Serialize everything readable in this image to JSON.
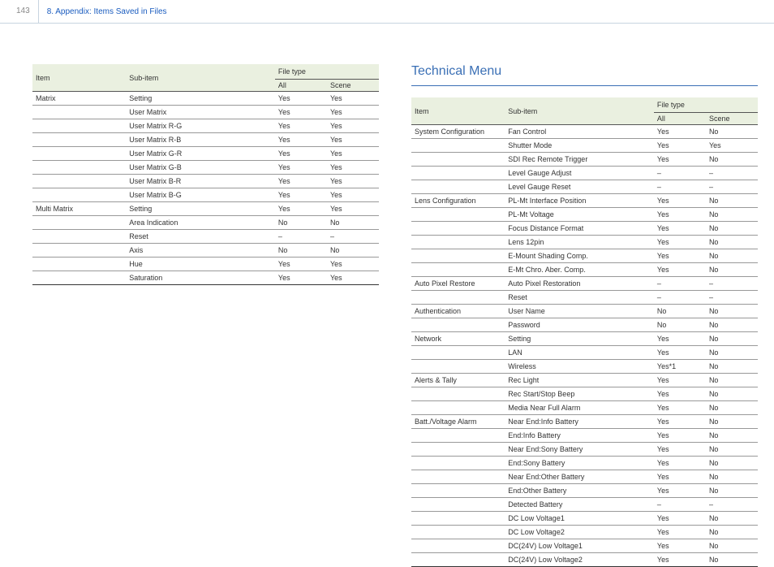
{
  "header": {
    "page_number": "143",
    "title": "8. Appendix: Items Saved in Files"
  },
  "table_headers": {
    "item": "Item",
    "sub_item": "Sub-item",
    "file_type": "File type",
    "all": "All",
    "scene": "Scene"
  },
  "right_heading": "Technical Menu",
  "left_table": [
    {
      "item": "Matrix",
      "rows": [
        {
          "sub": "Setting",
          "all": "Yes",
          "scene": "Yes"
        },
        {
          "sub": "User Matrix",
          "all": "Yes",
          "scene": "Yes"
        },
        {
          "sub": "User Matrix R-G",
          "all": "Yes",
          "scene": "Yes"
        },
        {
          "sub": "User Matrix R-B",
          "all": "Yes",
          "scene": "Yes"
        },
        {
          "sub": "User Matrix G-R",
          "all": "Yes",
          "scene": "Yes"
        },
        {
          "sub": "User Matrix G-B",
          "all": "Yes",
          "scene": "Yes"
        },
        {
          "sub": "User Matrix B-R",
          "all": "Yes",
          "scene": "Yes"
        },
        {
          "sub": "User Matrix B-G",
          "all": "Yes",
          "scene": "Yes"
        }
      ]
    },
    {
      "item": "Multi Matrix",
      "rows": [
        {
          "sub": "Setting",
          "all": "Yes",
          "scene": "Yes"
        },
        {
          "sub": "Area Indication",
          "all": "No",
          "scene": "No"
        },
        {
          "sub": "Reset",
          "all": "–",
          "scene": "–"
        },
        {
          "sub": "Axis",
          "all": "No",
          "scene": "No"
        },
        {
          "sub": "Hue",
          "all": "Yes",
          "scene": "Yes"
        },
        {
          "sub": "Saturation",
          "all": "Yes",
          "scene": "Yes"
        }
      ]
    }
  ],
  "right_table": [
    {
      "item": "System Configuration",
      "rows": [
        {
          "sub": "Fan Control",
          "all": "Yes",
          "scene": "No"
        },
        {
          "sub": "Shutter Mode",
          "all": "Yes",
          "scene": "Yes"
        },
        {
          "sub": "SDI Rec Remote Trigger",
          "all": "Yes",
          "scene": "No"
        },
        {
          "sub": "Level Gauge Adjust",
          "all": "–",
          "scene": "–"
        },
        {
          "sub": "Level Gauge Reset",
          "all": "–",
          "scene": "–"
        }
      ]
    },
    {
      "item": "Lens Configuration",
      "rows": [
        {
          "sub": "PL-Mt Interface Position",
          "all": "Yes",
          "scene": "No"
        },
        {
          "sub": "PL-Mt Voltage",
          "all": "Yes",
          "scene": "No"
        },
        {
          "sub": "Focus Distance Format",
          "all": "Yes",
          "scene": "No"
        },
        {
          "sub": "Lens 12pin",
          "all": "Yes",
          "scene": "No"
        },
        {
          "sub": "E-Mount Shading Comp.",
          "all": "Yes",
          "scene": "No"
        },
        {
          "sub": "E-Mt Chro. Aber. Comp.",
          "all": "Yes",
          "scene": "No"
        }
      ]
    },
    {
      "item": "Auto Pixel Restore",
      "rows": [
        {
          "sub": "Auto Pixel Restoration",
          "all": "–",
          "scene": "–"
        },
        {
          "sub": "Reset",
          "all": "–",
          "scene": "–"
        }
      ]
    },
    {
      "item": "Authentication",
      "rows": [
        {
          "sub": "User Name",
          "all": "No",
          "scene": "No"
        },
        {
          "sub": "Password",
          "all": "No",
          "scene": "No"
        }
      ]
    },
    {
      "item": "Network",
      "rows": [
        {
          "sub": "Setting",
          "all": "Yes",
          "scene": "No"
        },
        {
          "sub": "LAN",
          "all": "Yes",
          "scene": "No"
        },
        {
          "sub": "Wireless",
          "all": "Yes*1",
          "scene": "No"
        }
      ]
    },
    {
      "item": "Alerts & Tally",
      "rows": [
        {
          "sub": "Rec Light",
          "all": "Yes",
          "scene": "No"
        },
        {
          "sub": "Rec Start/Stop Beep",
          "all": "Yes",
          "scene": "No"
        },
        {
          "sub": "Media Near Full Alarm",
          "all": "Yes",
          "scene": "No"
        }
      ]
    },
    {
      "item": "Batt./Voltage Alarm",
      "rows": [
        {
          "sub": "Near End:Info Battery",
          "all": "Yes",
          "scene": "No"
        },
        {
          "sub": "End:Info Battery",
          "all": "Yes",
          "scene": "No"
        },
        {
          "sub": "Near End:Sony Battery",
          "all": "Yes",
          "scene": "No"
        },
        {
          "sub": "End:Sony Battery",
          "all": "Yes",
          "scene": "No"
        },
        {
          "sub": "Near End:Other Battery",
          "all": "Yes",
          "scene": "No"
        },
        {
          "sub": "End:Other Battery",
          "all": "Yes",
          "scene": "No"
        },
        {
          "sub": "Detected Battery",
          "all": "–",
          "scene": "–"
        },
        {
          "sub": "DC Low Voltage1",
          "all": "Yes",
          "scene": "No"
        },
        {
          "sub": "DC Low Voltage2",
          "all": "Yes",
          "scene": "No"
        },
        {
          "sub": "DC(24V) Low Voltage1",
          "all": "Yes",
          "scene": "No"
        },
        {
          "sub": "DC(24V) Low Voltage2",
          "all": "Yes",
          "scene": "No"
        }
      ]
    }
  ]
}
